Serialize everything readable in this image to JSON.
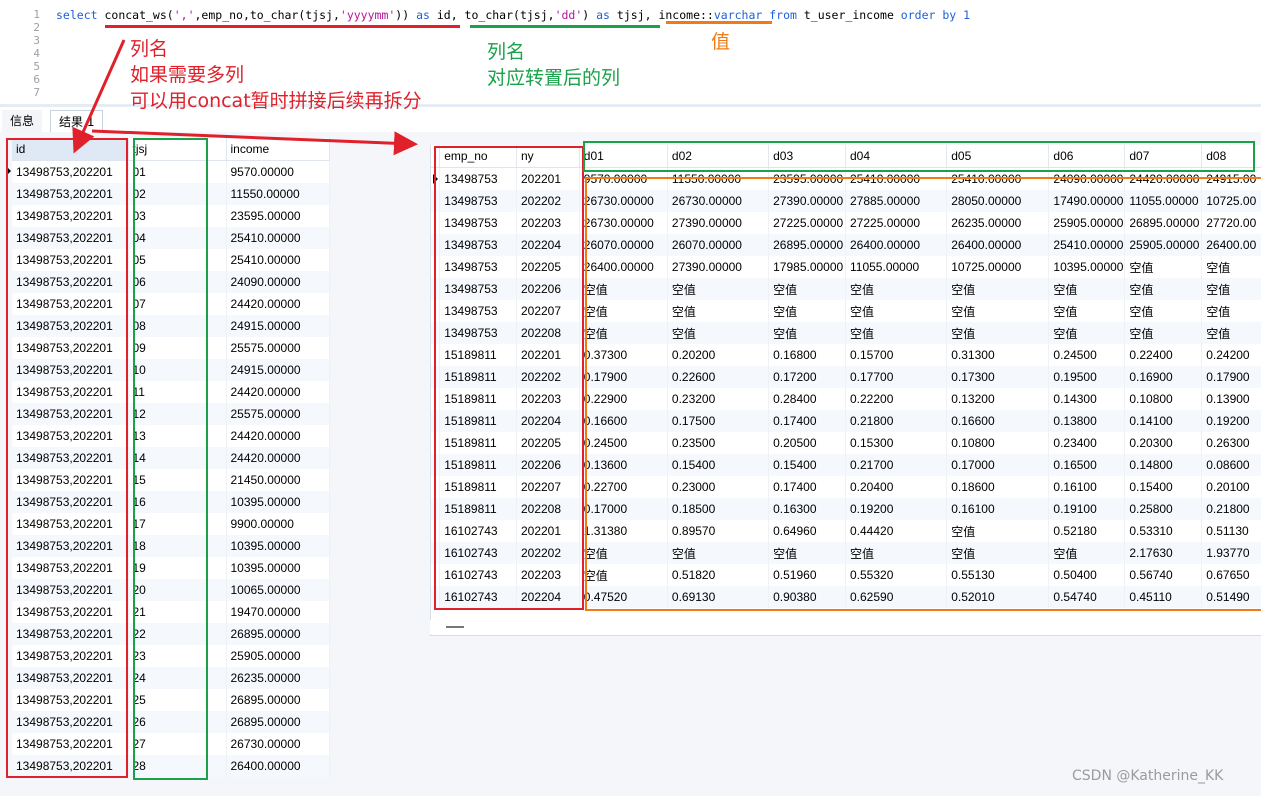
{
  "editor": {
    "line_numbers": [
      "1",
      "2",
      "3",
      "4",
      "5",
      "6",
      "7"
    ],
    "sql": [
      {
        "t": "select ",
        "c": "kw"
      },
      {
        "t": "concat_ws(",
        "c": ""
      },
      {
        "t": "','",
        "c": "str"
      },
      {
        "t": ",emp_no,to_char(tjsj,",
        "c": ""
      },
      {
        "t": "'yyyymm'",
        "c": "str"
      },
      {
        "t": ")) ",
        "c": ""
      },
      {
        "t": "as ",
        "c": "kw"
      },
      {
        "t": "id, to_char(tjsj,",
        "c": ""
      },
      {
        "t": "'dd'",
        "c": "str"
      },
      {
        "t": ") ",
        "c": ""
      },
      {
        "t": "as ",
        "c": "kw"
      },
      {
        "t": "tjsj, income::",
        "c": ""
      },
      {
        "t": "varchar ",
        "c": "kw"
      },
      {
        "t": "from ",
        "c": "kw"
      },
      {
        "t": "t_user_income ",
        "c": ""
      },
      {
        "t": "order by ",
        "c": "kw"
      },
      {
        "t": "1",
        "c": "num"
      }
    ]
  },
  "tabs": [
    "信息",
    "结果 1"
  ],
  "left_table": {
    "columns": [
      "id",
      "tjsj",
      "income"
    ],
    "rows": [
      [
        "13498753,202201",
        "01",
        "9570.00000"
      ],
      [
        "13498753,202201",
        "02",
        "11550.00000"
      ],
      [
        "13498753,202201",
        "03",
        "23595.00000"
      ],
      [
        "13498753,202201",
        "04",
        "25410.00000"
      ],
      [
        "13498753,202201",
        "05",
        "25410.00000"
      ],
      [
        "13498753,202201",
        "06",
        "24090.00000"
      ],
      [
        "13498753,202201",
        "07",
        "24420.00000"
      ],
      [
        "13498753,202201",
        "08",
        "24915.00000"
      ],
      [
        "13498753,202201",
        "09",
        "25575.00000"
      ],
      [
        "13498753,202201",
        "10",
        "24915.00000"
      ],
      [
        "13498753,202201",
        "11",
        "24420.00000"
      ],
      [
        "13498753,202201",
        "12",
        "25575.00000"
      ],
      [
        "13498753,202201",
        "13",
        "24420.00000"
      ],
      [
        "13498753,202201",
        "14",
        "24420.00000"
      ],
      [
        "13498753,202201",
        "15",
        "21450.00000"
      ],
      [
        "13498753,202201",
        "16",
        "10395.00000"
      ],
      [
        "13498753,202201",
        "17",
        "9900.00000"
      ],
      [
        "13498753,202201",
        "18",
        "10395.00000"
      ],
      [
        "13498753,202201",
        "19",
        "10395.00000"
      ],
      [
        "13498753,202201",
        "20",
        "10065.00000"
      ],
      [
        "13498753,202201",
        "21",
        "19470.00000"
      ],
      [
        "13498753,202201",
        "22",
        "26895.00000"
      ],
      [
        "13498753,202201",
        "23",
        "25905.00000"
      ],
      [
        "13498753,202201",
        "24",
        "26235.00000"
      ],
      [
        "13498753,202201",
        "25",
        "26895.00000"
      ],
      [
        "13498753,202201",
        "26",
        "26895.00000"
      ],
      [
        "13498753,202201",
        "27",
        "26730.00000"
      ],
      [
        "13498753,202201",
        "28",
        "26400.00000"
      ]
    ]
  },
  "right_table": {
    "columns": [
      "emp_no",
      "ny",
      "d01",
      "d02",
      "d03",
      "d04",
      "d05",
      "d06",
      "d07",
      "d08"
    ],
    "rows": [
      [
        "13498753",
        "202201",
        "9570.00000",
        "11550.00000",
        "23595.00000",
        "25410.00000",
        "25410.00000",
        "24090.00000",
        "24420.00000",
        "24915.00"
      ],
      [
        "13498753",
        "202202",
        "26730.00000",
        "26730.00000",
        "27390.00000",
        "27885.00000",
        "28050.00000",
        "17490.00000",
        "11055.00000",
        "10725.00"
      ],
      [
        "13498753",
        "202203",
        "26730.00000",
        "27390.00000",
        "27225.00000",
        "27225.00000",
        "26235.00000",
        "25905.00000",
        "26895.00000",
        "27720.00"
      ],
      [
        "13498753",
        "202204",
        "26070.00000",
        "26070.00000",
        "26895.00000",
        "26400.00000",
        "26400.00000",
        "25410.00000",
        "25905.00000",
        "26400.00"
      ],
      [
        "13498753",
        "202205",
        "26400.00000",
        "27390.00000",
        "17985.00000",
        "11055.00000",
        "10725.00000",
        "10395.00000",
        "空值",
        "空值"
      ],
      [
        "13498753",
        "202206",
        "空值",
        "空值",
        "空值",
        "空值",
        "空值",
        "空值",
        "空值",
        "空值"
      ],
      [
        "13498753",
        "202207",
        "空值",
        "空值",
        "空值",
        "空值",
        "空值",
        "空值",
        "空值",
        "空值"
      ],
      [
        "13498753",
        "202208",
        "空值",
        "空值",
        "空值",
        "空值",
        "空值",
        "空值",
        "空值",
        "空值"
      ],
      [
        "15189811",
        "202201",
        "0.37300",
        "0.20200",
        "0.16800",
        "0.15700",
        "0.31300",
        "0.24500",
        "0.22400",
        "0.24200"
      ],
      [
        "15189811",
        "202202",
        "0.17900",
        "0.22600",
        "0.17200",
        "0.17700",
        "0.17300",
        "0.19500",
        "0.16900",
        "0.17900"
      ],
      [
        "15189811",
        "202203",
        "0.22900",
        "0.23200",
        "0.28400",
        "0.22200",
        "0.13200",
        "0.14300",
        "0.10800",
        "0.13900"
      ],
      [
        "15189811",
        "202204",
        "0.16600",
        "0.17500",
        "0.17400",
        "0.21800",
        "0.16600",
        "0.13800",
        "0.14100",
        "0.19200"
      ],
      [
        "15189811",
        "202205",
        "0.24500",
        "0.23500",
        "0.20500",
        "0.15300",
        "0.10800",
        "0.23400",
        "0.20300",
        "0.26300"
      ],
      [
        "15189811",
        "202206",
        "0.13600",
        "0.15400",
        "0.15400",
        "0.21700",
        "0.17000",
        "0.16500",
        "0.14800",
        "0.08600"
      ],
      [
        "15189811",
        "202207",
        "0.22700",
        "0.23000",
        "0.17400",
        "0.20400",
        "0.18600",
        "0.16100",
        "0.15400",
        "0.20100"
      ],
      [
        "15189811",
        "202208",
        "0.17000",
        "0.18500",
        "0.16300",
        "0.19200",
        "0.16100",
        "0.19100",
        "0.25800",
        "0.21800"
      ],
      [
        "16102743",
        "202201",
        "1.31380",
        "0.89570",
        "0.64960",
        "0.44420",
        "空值",
        "0.52180",
        "0.53310",
        "0.51130"
      ],
      [
        "16102743",
        "202202",
        "空值",
        "空值",
        "空值",
        "空值",
        "空值",
        "空值",
        "2.17630",
        "1.93770"
      ],
      [
        "16102743",
        "202203",
        "空值",
        "0.51820",
        "0.51960",
        "0.55320",
        "0.55130",
        "0.50400",
        "0.56740",
        "0.67650"
      ],
      [
        "16102743",
        "202204",
        "0.47520",
        "0.69130",
        "0.90380",
        "0.62590",
        "0.52010",
        "0.54740",
        "0.45110",
        "0.51490"
      ]
    ]
  },
  "annotations": {
    "red_label": [
      "列名",
      "如果需要多列",
      "可以用concat暂时拼接后续再拆分"
    ],
    "green_label": [
      "列名",
      "对应转置后的列"
    ],
    "orange_label": "值",
    "colors": {
      "red": "#e0202a",
      "green": "#1aa24a",
      "orange": "#f07b16"
    }
  },
  "watermark": "CSDN @Katherine_KK"
}
